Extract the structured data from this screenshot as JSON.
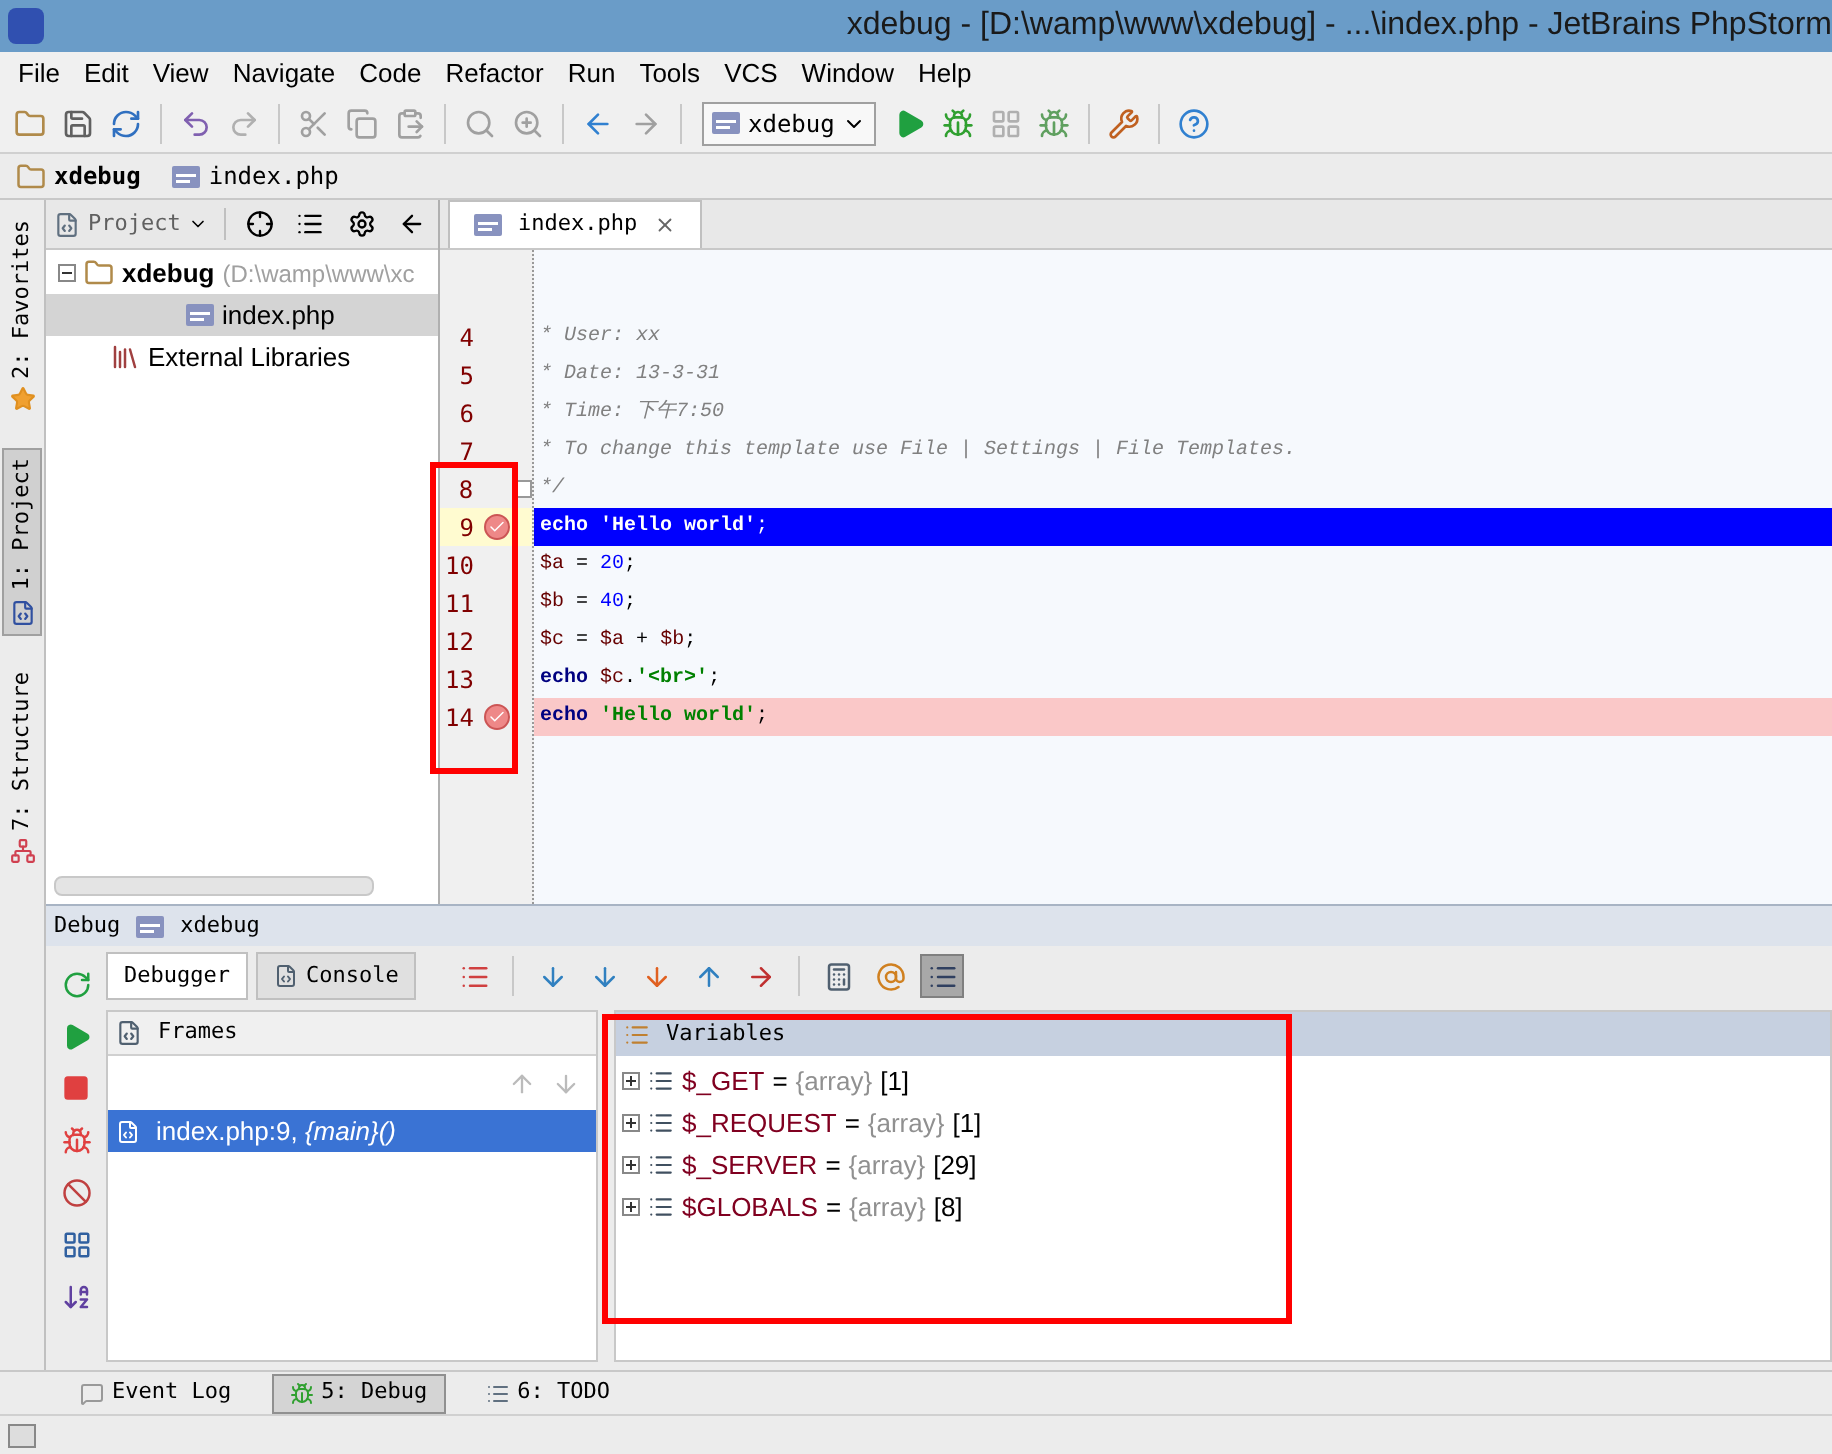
{
  "window": {
    "title": "xdebug - [D:\\wamp\\www\\xdebug] - ...\\index.php - JetBrains PhpStorm"
  },
  "menu": [
    "File",
    "Edit",
    "View",
    "Navigate",
    "Code",
    "Refactor",
    "Run",
    "Tools",
    "VCS",
    "Window",
    "Help"
  ],
  "run_config": {
    "label": "xdebug"
  },
  "breadcrumb": [
    {
      "label": "xdebug",
      "kind": "folder"
    },
    {
      "label": "index.php",
      "kind": "php"
    }
  ],
  "side_tabs": [
    {
      "label": "2: Favorites",
      "selected": false,
      "kind": "favorites"
    },
    {
      "label": "1: Project",
      "selected": true,
      "kind": "project"
    },
    {
      "label": "7: Structure",
      "selected": false,
      "kind": "structure"
    }
  ],
  "project": {
    "header": "Project",
    "tree": [
      {
        "label": "xdebug",
        "path": "(D:\\wamp\\www\\xc",
        "kind": "folder",
        "expanded": true,
        "selected": false,
        "children": [
          {
            "label": "index.php",
            "kind": "php",
            "selected": true
          }
        ]
      },
      {
        "label": "External Libraries",
        "kind": "library",
        "selected": false
      }
    ]
  },
  "editor": {
    "tabs": [
      {
        "label": "index.php",
        "selected": true
      }
    ],
    "lines": [
      {
        "number": "4",
        "breakpoint": false,
        "current": false,
        "fold": false,
        "tokens": [
          {
            "kind": "comment",
            "text": "* User: xx"
          }
        ]
      },
      {
        "number": "5",
        "breakpoint": false,
        "current": false,
        "fold": false,
        "tokens": [
          {
            "kind": "comment",
            "text": "* Date: 13-3-31"
          }
        ]
      },
      {
        "number": "6",
        "breakpoint": false,
        "current": false,
        "fold": false,
        "tokens": [
          {
            "kind": "comment",
            "text": "* Time: 下午7:50"
          }
        ]
      },
      {
        "number": "7",
        "breakpoint": false,
        "current": false,
        "fold": false,
        "tokens": [
          {
            "kind": "comment",
            "text": "* To change this template use File | Settings | File Templates."
          }
        ]
      },
      {
        "number": "8",
        "breakpoint": false,
        "current": false,
        "fold": true,
        "tokens": [
          {
            "kind": "comment",
            "text": "*/"
          }
        ]
      },
      {
        "number": "9",
        "breakpoint": true,
        "current": true,
        "fold": false,
        "tokens": [
          {
            "kind": "keyword",
            "text": "echo"
          },
          {
            "kind": "string",
            "text": " 'Hello world'"
          },
          {
            "kind": "plain",
            "text": ";"
          }
        ]
      },
      {
        "number": "10",
        "breakpoint": false,
        "current": false,
        "fold": false,
        "tokens": [
          {
            "kind": "variable",
            "text": "$a"
          },
          {
            "kind": "plain",
            "text": " = "
          },
          {
            "kind": "number",
            "text": "20"
          },
          {
            "kind": "plain",
            "text": ";"
          }
        ]
      },
      {
        "number": "11",
        "breakpoint": false,
        "current": false,
        "fold": false,
        "tokens": [
          {
            "kind": "variable",
            "text": "$b"
          },
          {
            "kind": "plain",
            "text": " = "
          },
          {
            "kind": "number",
            "text": "40"
          },
          {
            "kind": "plain",
            "text": ";"
          }
        ]
      },
      {
        "number": "12",
        "breakpoint": false,
        "current": false,
        "fold": false,
        "tokens": [
          {
            "kind": "variable",
            "text": "$c"
          },
          {
            "kind": "plain",
            "text": " = "
          },
          {
            "kind": "variable",
            "text": "$a"
          },
          {
            "kind": "plain",
            "text": " + "
          },
          {
            "kind": "variable",
            "text": "$b"
          },
          {
            "kind": "plain",
            "text": ";"
          }
        ]
      },
      {
        "number": "13",
        "breakpoint": false,
        "current": false,
        "fold": false,
        "tokens": [
          {
            "kind": "keyword",
            "text": "echo"
          },
          {
            "kind": "variable",
            "text": " $c"
          },
          {
            "kind": "plain",
            "text": "."
          },
          {
            "kind": "string",
            "text": "'<br>'"
          },
          {
            "kind": "plain",
            "text": ";"
          }
        ]
      },
      {
        "number": "14",
        "breakpoint": true,
        "current": false,
        "fold": false,
        "tokens": [
          {
            "kind": "keyword",
            "text": "echo"
          },
          {
            "kind": "string",
            "text": " 'Hello world'"
          },
          {
            "kind": "plain",
            "text": ";"
          }
        ]
      }
    ]
  },
  "debug": {
    "title": "Debug",
    "config": "xdebug",
    "tabs": [
      {
        "label": "Debugger",
        "selected": true
      },
      {
        "label": "Console",
        "selected": false
      }
    ],
    "last_tool_pressed": true,
    "frames": {
      "header": "Frames",
      "items": [
        {
          "text": "index.php:9, *{main}()*",
          "selected": true
        }
      ]
    },
    "variables": {
      "header": "Variables",
      "items": [
        {
          "name": "$_GET",
          "operator": "=",
          "type": "{array}",
          "count": "[1]"
        },
        {
          "name": "$_REQUEST",
          "operator": "=",
          "type": "{array}",
          "count": "[1]"
        },
        {
          "name": "$_SERVER",
          "operator": "=",
          "type": "{array}",
          "count": "[29]"
        },
        {
          "name": "$GLOBALS",
          "operator": "=",
          "type": "{array}",
          "count": "[8]"
        }
      ]
    }
  },
  "bottom_tabs": [
    {
      "label": "Event Log",
      "selected": false,
      "kind": "log"
    },
    {
      "label": "5: Debug",
      "selected": true,
      "kind": "debug"
    },
    {
      "label": "6: TODO",
      "selected": false,
      "kind": "todo"
    }
  ]
}
